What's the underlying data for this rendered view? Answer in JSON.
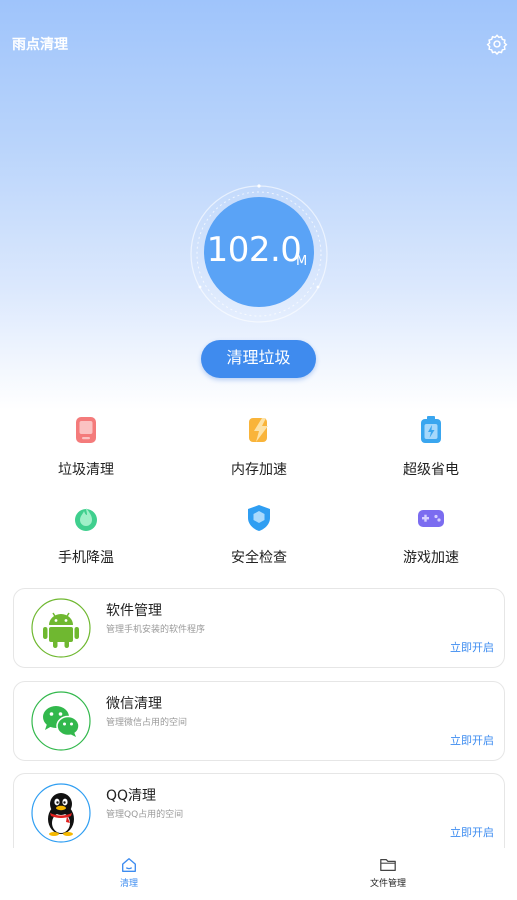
{
  "header": {
    "title": "雨点清理",
    "settings_icon": "gear-icon"
  },
  "gauge": {
    "value": "102.0",
    "unit": "M"
  },
  "clean_button": {
    "label": "清理垃圾"
  },
  "features": [
    {
      "label": "垃圾清理",
      "icon": "phone-trash-icon",
      "color": "#f06161"
    },
    {
      "label": "内存加速",
      "icon": "lightning-icon",
      "color": "#f7a928"
    },
    {
      "label": "超级省电",
      "icon": "battery-icon",
      "color": "#3aa6ef"
    },
    {
      "label": "手机降温",
      "icon": "flame-icon",
      "color": "#34c68a"
    },
    {
      "label": "安全检查",
      "icon": "shield-icon",
      "color": "#2f9ef2"
    },
    {
      "label": "游戏加速",
      "icon": "gamepad-icon",
      "color": "#7b6cf0"
    }
  ],
  "cards": [
    {
      "title": "软件管理",
      "desc": "管理手机安装的软件程序",
      "action": "立即开启",
      "icon": "android-icon",
      "border": "#6fb830"
    },
    {
      "title": "微信清理",
      "desc": "管理微信占用的空间",
      "action": "立即开启",
      "icon": "wechat-icon",
      "border": "#32b84c"
    },
    {
      "title": "QQ清理",
      "desc": "管理QQ占用的空间",
      "action": "立即开启",
      "icon": "qq-penguin-icon",
      "border": "#2f9ef2"
    }
  ],
  "nav": [
    {
      "label": "清理",
      "icon": "home-icon",
      "active": true,
      "color": "#3d8cf0"
    },
    {
      "label": "文件管理",
      "icon": "folder-icon",
      "active": false,
      "color": "#222222"
    }
  ]
}
